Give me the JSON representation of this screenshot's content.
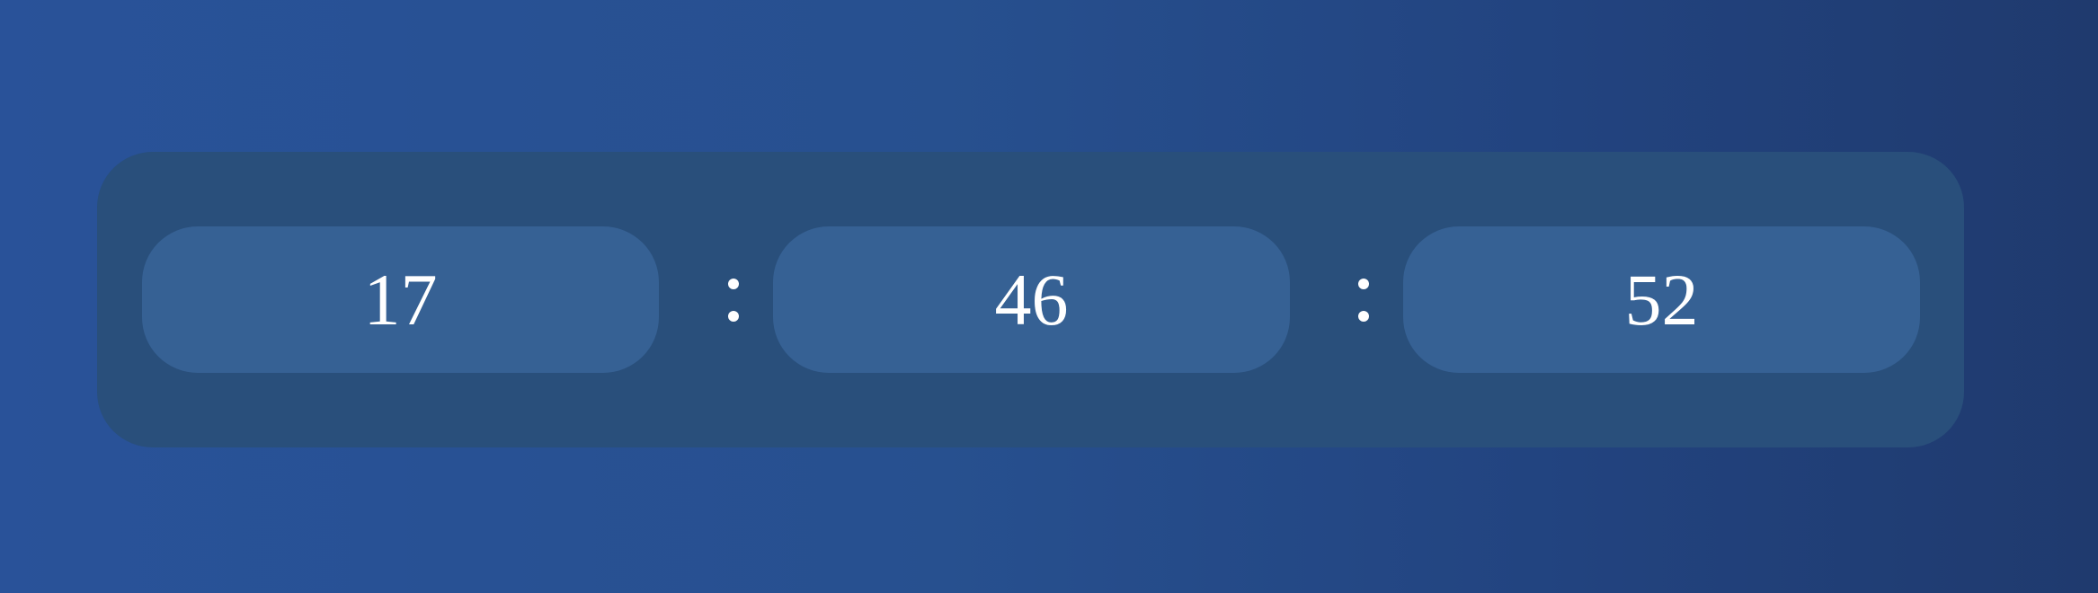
{
  "clock": {
    "hours": "17",
    "minutes": "46",
    "seconds": "52",
    "separator": ":"
  },
  "colors": {
    "background_start": "#295299",
    "background_end": "#1f3a6e",
    "panel": "#294f7b",
    "segment": "#366194",
    "text": "#ffffff"
  }
}
